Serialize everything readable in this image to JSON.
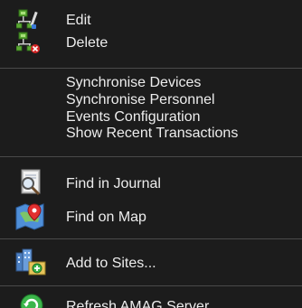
{
  "menu": {
    "items": [
      {
        "label": "Edit",
        "icon": "network-edit-icon"
      },
      {
        "label": "Delete",
        "icon": "network-delete-icon"
      },
      {
        "label": "Synchronise Devices"
      },
      {
        "label": "Synchronise Personnel"
      },
      {
        "label": "Events Configuration"
      },
      {
        "label": "Show Recent Transactions"
      },
      {
        "label": "Find in Journal",
        "icon": "journal-search-icon"
      },
      {
        "label": "Find on Map",
        "icon": "map-pin-icon"
      },
      {
        "label": "Add to Sites...",
        "icon": "sites-add-icon"
      },
      {
        "label": "Refresh AMAG Server",
        "icon": "refresh-icon"
      }
    ]
  },
  "colors": {
    "background": "#1c1c1c",
    "text": "#ededed",
    "separator": "#4a4a4a"
  }
}
